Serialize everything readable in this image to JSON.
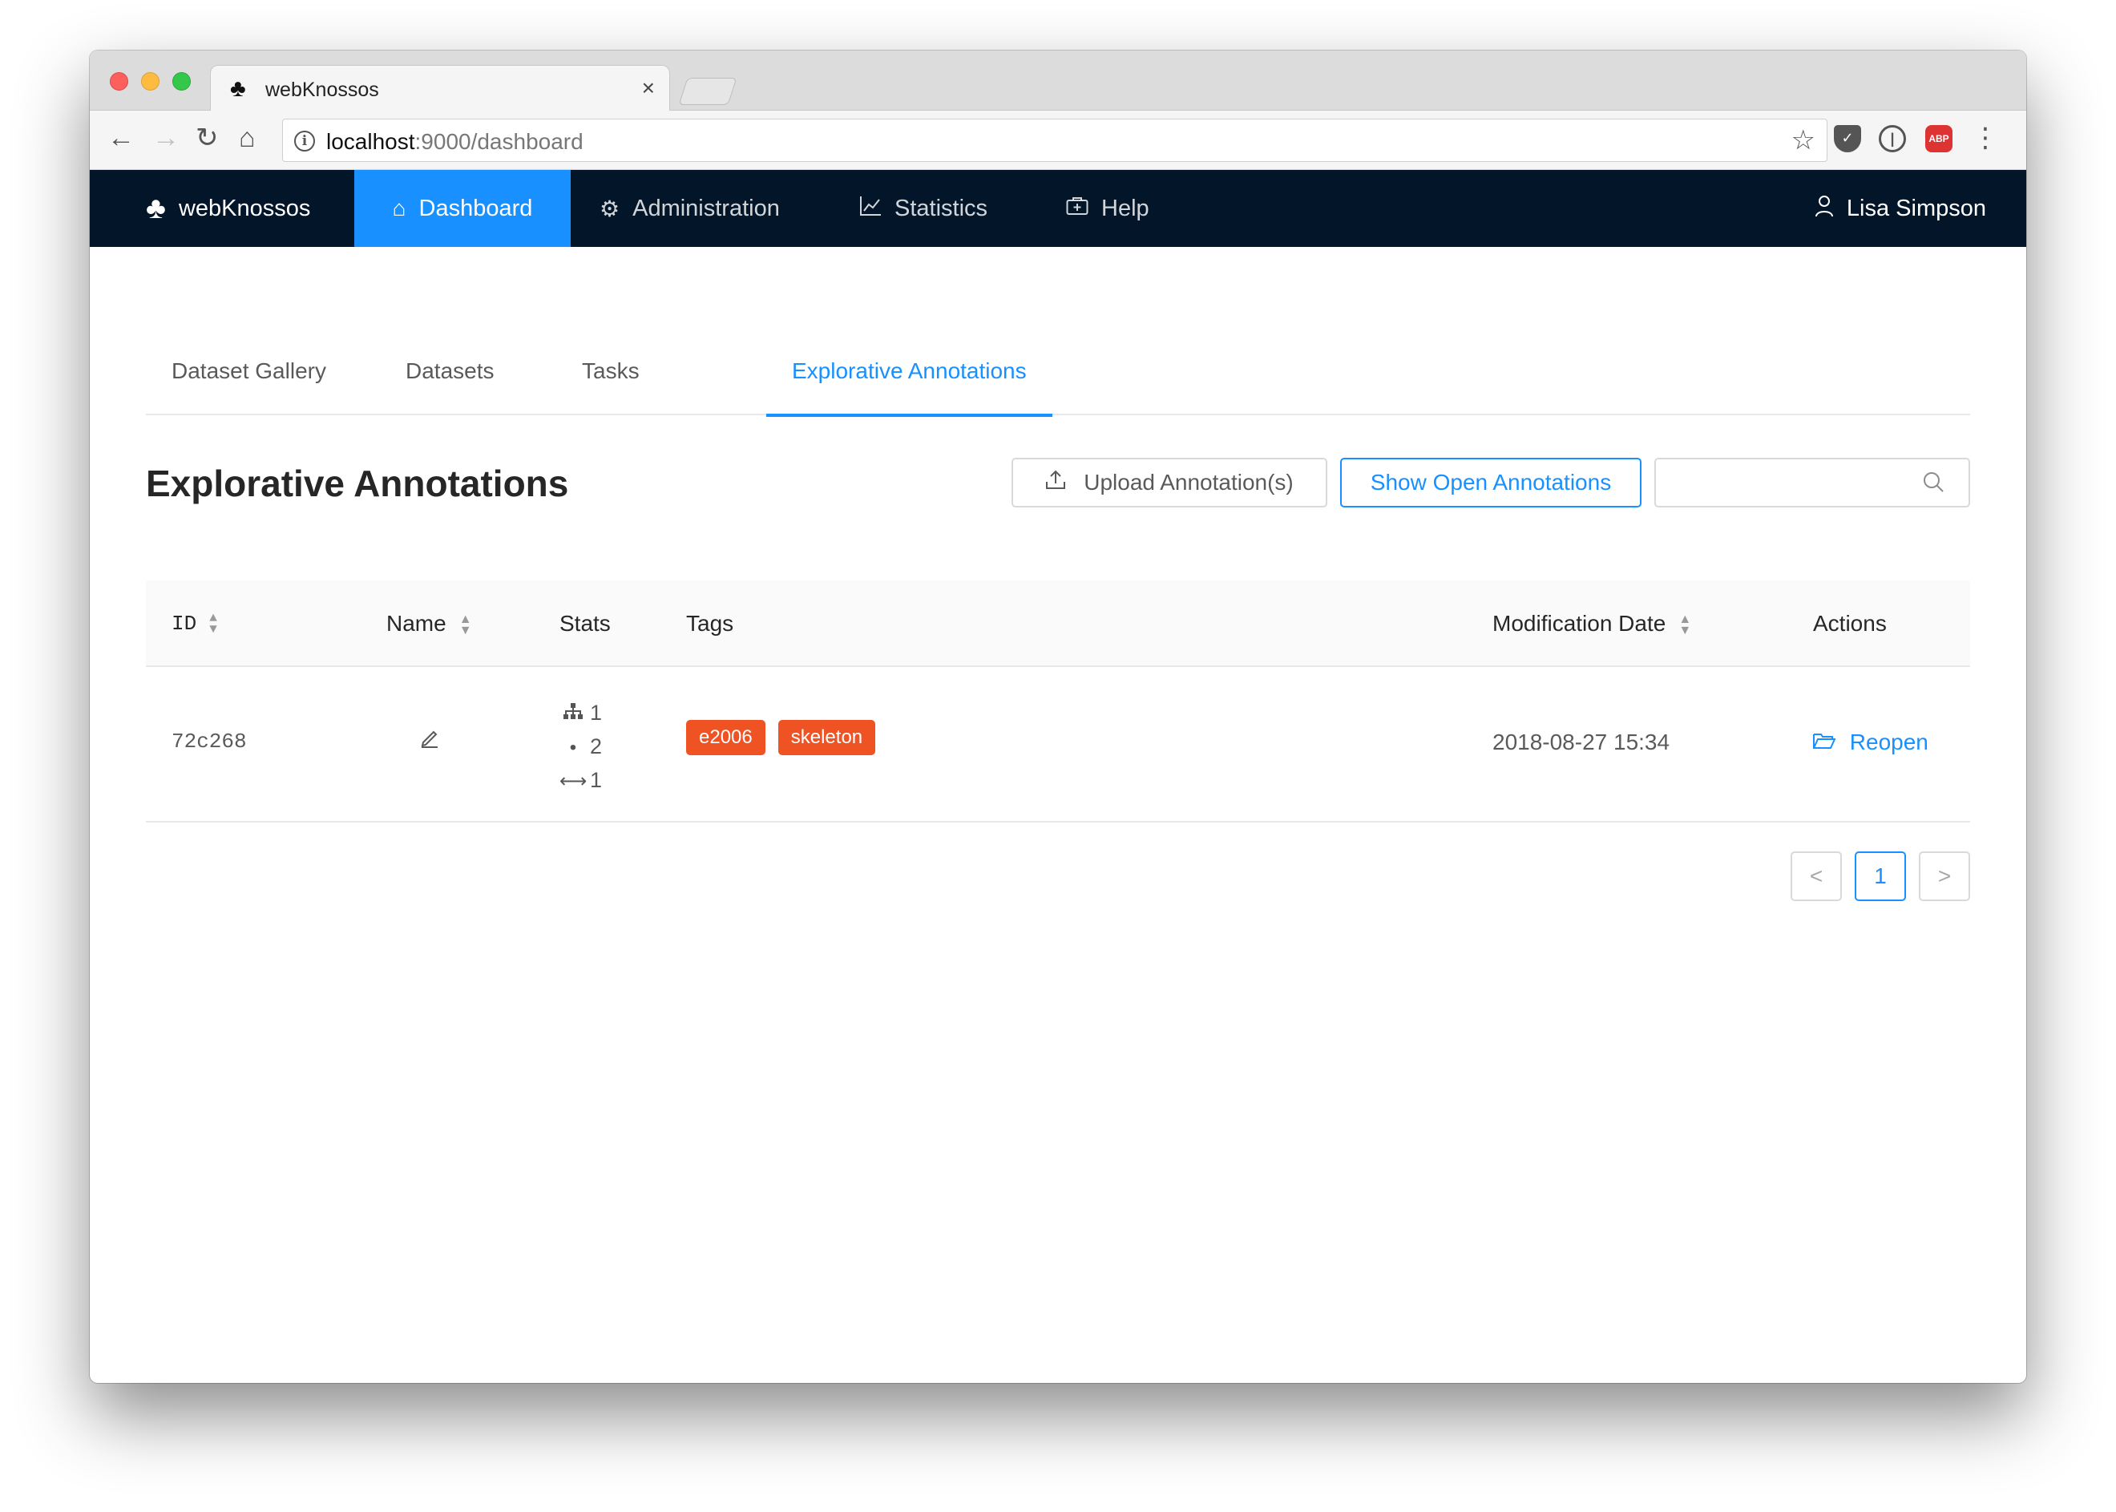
{
  "browser": {
    "tab_title": "webKnossos",
    "tab_close": "×",
    "url_host": "localhost",
    "url_path": ":9000/dashboard",
    "back_icon": "←",
    "forward_icon": "→",
    "reload_icon": "↻",
    "home_icon": "⌂",
    "star_icon": "☆",
    "menu_icon": "⋮",
    "abp_label": "ABP"
  },
  "navbar": {
    "brand": "webKnossos",
    "items": [
      {
        "label": "Dashboard",
        "icon": "home-icon",
        "active": true
      },
      {
        "label": "Administration",
        "icon": "gear-icon"
      },
      {
        "label": "Statistics",
        "icon": "line-chart-icon"
      },
      {
        "label": "Help",
        "icon": "medicine-box-icon"
      }
    ],
    "user": "Lisa Simpson"
  },
  "tabs": [
    {
      "label": "Dataset Gallery"
    },
    {
      "label": "Datasets"
    },
    {
      "label": "Tasks"
    },
    {
      "label": "Explorative Annotations",
      "active": true
    }
  ],
  "page": {
    "title": "Explorative Annotations",
    "upload_button": "Upload Annotation(s)",
    "show_open_button": "Show Open Annotations",
    "search_placeholder": ""
  },
  "table": {
    "columns": [
      "ID",
      "Name",
      "Stats",
      "Tags",
      "Modification Date",
      "Actions"
    ],
    "rows": [
      {
        "id": "72c268",
        "stats": {
          "trees": "1",
          "nodes": "2",
          "edges": "1"
        },
        "tags": [
          "e2006",
          "skeleton"
        ],
        "modification_date": "2018-08-27 15:34",
        "action": "Reopen"
      }
    ]
  },
  "pagination": {
    "prev": "<",
    "current": "1",
    "next": ">"
  },
  "colors": {
    "navbar": "#021529",
    "accent": "#1890ff",
    "tag": "#f05323"
  }
}
